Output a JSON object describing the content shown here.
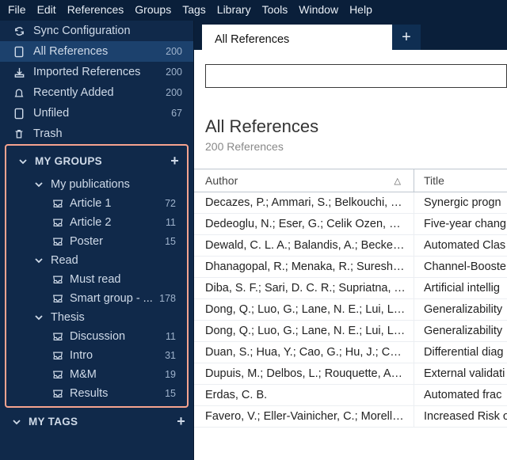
{
  "menubar": [
    "File",
    "Edit",
    "References",
    "Groups",
    "Tags",
    "Library",
    "Tools",
    "Window",
    "Help"
  ],
  "sidebar": {
    "top": [
      {
        "icon": "sync",
        "label": "Sync Configuration",
        "count": ""
      },
      {
        "icon": "doc",
        "label": "All References",
        "count": "200",
        "active": true
      },
      {
        "icon": "import",
        "label": "Imported References",
        "count": "200"
      },
      {
        "icon": "bell",
        "label": "Recently Added",
        "count": "200"
      },
      {
        "icon": "doc",
        "label": "Unfiled",
        "count": "67"
      },
      {
        "icon": "trash",
        "label": "Trash",
        "count": ""
      }
    ],
    "groups_title": "MY GROUPS",
    "groups": [
      {
        "type": "folder",
        "depth": 1,
        "label": "My publications"
      },
      {
        "type": "item",
        "depth": 2,
        "label": "Article 1",
        "count": "72"
      },
      {
        "type": "item",
        "depth": 2,
        "label": "Article 2",
        "count": "11"
      },
      {
        "type": "item",
        "depth": 2,
        "label": "Poster",
        "count": "15"
      },
      {
        "type": "folder",
        "depth": 1,
        "label": "Read"
      },
      {
        "type": "item",
        "depth": 2,
        "label": "Must read",
        "count": ""
      },
      {
        "type": "item",
        "depth": 2,
        "label": "Smart group - ...",
        "count": "178"
      },
      {
        "type": "folder",
        "depth": 1,
        "label": "Thesis"
      },
      {
        "type": "item",
        "depth": 2,
        "label": "Discussion",
        "count": "11"
      },
      {
        "type": "item",
        "depth": 2,
        "label": "Intro",
        "count": "31"
      },
      {
        "type": "item",
        "depth": 2,
        "label": "M&M",
        "count": "19"
      },
      {
        "type": "item",
        "depth": 2,
        "label": "Results",
        "count": "15"
      }
    ],
    "tags_title": "MY TAGS"
  },
  "tab": {
    "label": "All References"
  },
  "search": {
    "placeholder": ""
  },
  "header": {
    "title": "All References",
    "subtitle": "200 References"
  },
  "columns": {
    "author": "Author",
    "title": "Title"
  },
  "rows": [
    {
      "author": "Decazes, P.; Ammari, S.; Belkouchi, Y.;...",
      "title": "Synergic progn"
    },
    {
      "author": "Dedeoglu, N.; Eser, G.; Celik Ozen, D.; ...",
      "title": "Five-year chang"
    },
    {
      "author": "Dewald, C. L. A.; Balandis, A.; Becker, ...",
      "title": "Automated Clas"
    },
    {
      "author": "Dhanagopal, R.; Menaka, R.; Suresh K...",
      "title": "Channel-Booste"
    },
    {
      "author": "Diba, S. F.; Sari, D. C. R.; Supriatna, Y.; ...",
      "title": "Artificial intellig"
    },
    {
      "author": "Dong, Q.; Luo, G.; Lane, N. E.; Lui, L. Y.;...",
      "title": "Generalizability"
    },
    {
      "author": "Dong, Q.; Luo, G.; Lane, N. E.; Lui, L. Y.;...",
      "title": "Generalizability"
    },
    {
      "author": "Duan, S.; Hua, Y.; Cao, G.; Hu, J.; Cui, ...",
      "title": "Differential diag"
    },
    {
      "author": "Dupuis, M.; Delbos, L.; Rouquette, A.; ...",
      "title": "External validati"
    },
    {
      "author": "Erdas, C. B.",
      "title": "Automated frac"
    },
    {
      "author": "Favero, V.; Eller-Vainicher, C.; Morelli, ...",
      "title": "Increased Risk o"
    }
  ]
}
